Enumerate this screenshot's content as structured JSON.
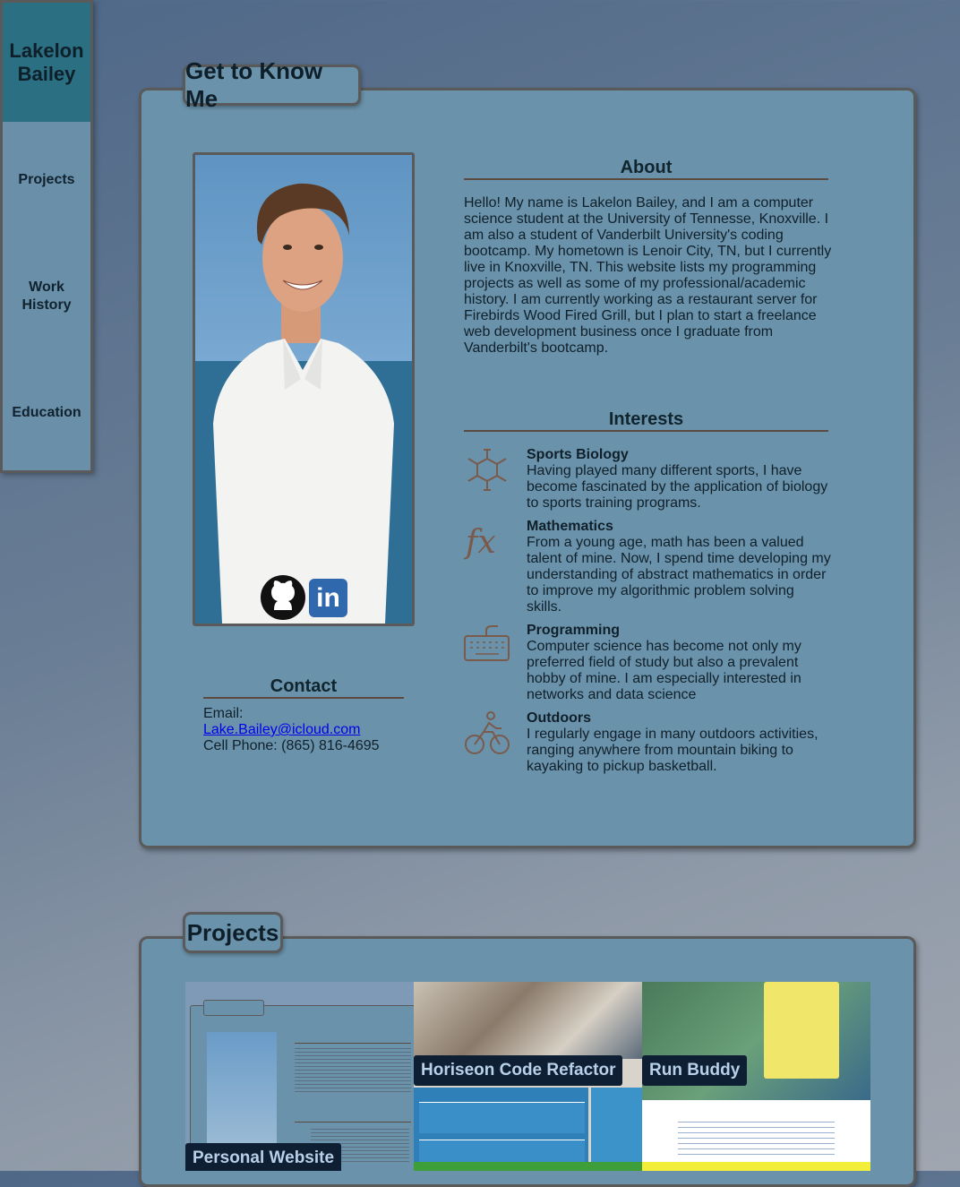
{
  "sidebar": {
    "brand": "Lakelon Bailey",
    "items": [
      {
        "label": "Projects"
      },
      {
        "label": "Work History"
      },
      {
        "label": "Education"
      }
    ]
  },
  "about_section": {
    "tab_label": "Get to Know Me",
    "about_title": "About",
    "about_text": "Hello! My name is Lakelon Bailey, and I am a computer science student at the University of Tennesse, Knoxville. I am also a student of Vanderbilt University's coding bootcamp. My hometown is Lenoir City, TN, but I currently live in Knoxville, TN. This website lists my programming projects as well as some of my professional/academic history. I am currently working as a restaurant server for Firebirds Wood Fired Grill, but I plan to start a freelance web development business once I graduate from Vanderbilt's bootcamp.",
    "interests_title": "Interests",
    "interests": [
      {
        "icon": "molecule-icon",
        "title": "Sports Biology",
        "text": "Having played many different sports, I have become fascinated by the application of biology to sports training programs."
      },
      {
        "icon": "function-icon",
        "title": "Mathematics",
        "text": "From a young age, math has been a valued talent of mine. Now, I spend time developing my understanding of abstract mathematics in order to improve my algorithmic problem solving skills."
      },
      {
        "icon": "keyboard-icon",
        "title": "Programming",
        "text": "Computer science has become not only my preferred field of study but also a prevalent hobby of mine. I am especially interested in networks and data science"
      },
      {
        "icon": "cyclist-icon",
        "title": "Outdoors",
        "text": "I regularly engage in many outdoors activities, ranging anywhere from mountain biking to kayaking to pickup basketball."
      }
    ],
    "contact_title": "Contact",
    "email_label": "Email: ",
    "email": "Lake.Bailey@icloud.com",
    "phone": "Cell Phone: (865) 816-4695",
    "social_icons": [
      "github-icon",
      "linkedin-icon"
    ]
  },
  "projects_section": {
    "tab_label": "Projects",
    "items": [
      {
        "label": "Personal Website"
      },
      {
        "label": "Horiseon Code Refactor"
      },
      {
        "label": "Run Buddy"
      }
    ]
  },
  "colors": {
    "card": "#6a92aa",
    "brand": "#2b6f82",
    "label_bg": "#0f1f33"
  }
}
